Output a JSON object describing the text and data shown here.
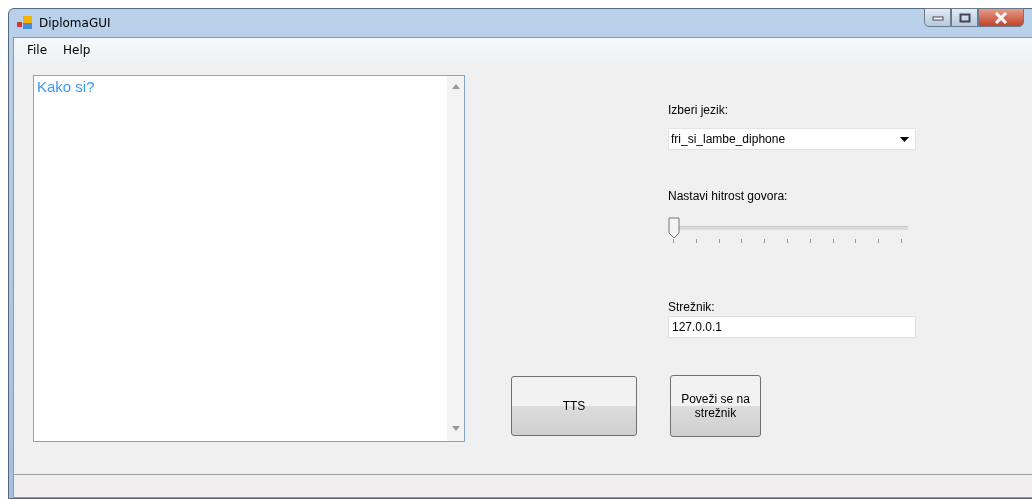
{
  "window": {
    "title": "DiplomaGUI"
  },
  "menu": [
    "File",
    "Help"
  ],
  "text_area": {
    "value": "Kako si?"
  },
  "language": {
    "label": "Izberi jezik:",
    "value": "fri_si_lambe_diphone"
  },
  "speed": {
    "label": "Nastavi hitrost govora:",
    "level": 0
  },
  "server": {
    "label": "Strežnik:",
    "value": "127.0.0.1"
  },
  "buttons": [
    "TTS",
    "Poveži se na strežnik"
  ]
}
